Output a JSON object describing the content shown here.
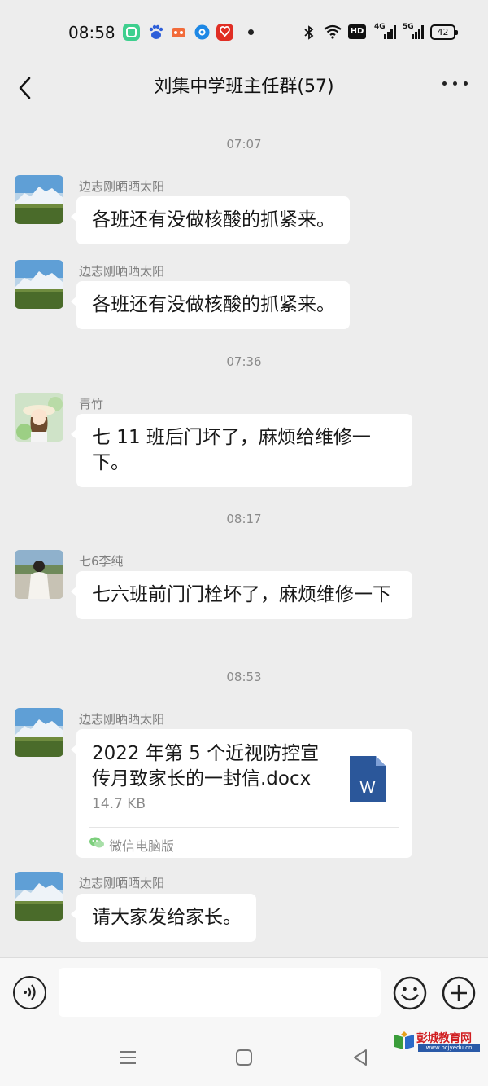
{
  "status_bar": {
    "time": "08:58",
    "network_hd": "HD",
    "network_1": "4G",
    "network_2": "5G",
    "battery": "42",
    "app_icons": [
      "message-icon",
      "baidu-icon",
      "game-icon",
      "browser-icon",
      "pinduoduo-icon"
    ]
  },
  "nav": {
    "title": "刘集中学班主任群(57)"
  },
  "messages": [
    {
      "type": "timestamp",
      "text": "07:07"
    },
    {
      "type": "text",
      "sender": "边志刚晒晒太阳",
      "avatar": "mountain-avatar",
      "text": "各班还有没做核酸的抓紧来。"
    },
    {
      "type": "text",
      "sender": "边志刚晒晒太阳",
      "avatar": "mountain-avatar",
      "text": "各班还有没做核酸的抓紧来。"
    },
    {
      "type": "timestamp",
      "text": "07:36"
    },
    {
      "type": "text",
      "sender": "青竹",
      "avatar": "girl-hat-avatar",
      "text": "七 11 班后门坏了，麻烦给维修一下。"
    },
    {
      "type": "timestamp",
      "text": "08:17"
    },
    {
      "type": "text",
      "sender": "七6李纯",
      "avatar": "girl-back-avatar",
      "text": "七六班前门门栓坏了，麻烦维修一下"
    },
    {
      "type": "timestamp",
      "text": "08:53"
    },
    {
      "type": "file",
      "sender": "边志刚晒晒太阳",
      "avatar": "mountain-avatar",
      "file_name": "2022 年第 5 个近视防控宣传月致家长的一封信.docx",
      "file_size": "14.7 KB",
      "file_icon": "word-doc-icon",
      "source": "微信电脑版"
    },
    {
      "type": "text",
      "sender": "边志刚晒晒太阳",
      "avatar": "mountain-avatar",
      "text": "请大家发给家长。"
    }
  ],
  "input": {
    "placeholder": ""
  },
  "watermark": {
    "text": "彭城教育网",
    "url": "www.pcjyedu.cn"
  },
  "colors": {
    "background": "#ededed",
    "bubble": "#ffffff",
    "word_icon": "#2b579a",
    "wechat_green": "#07c160"
  }
}
